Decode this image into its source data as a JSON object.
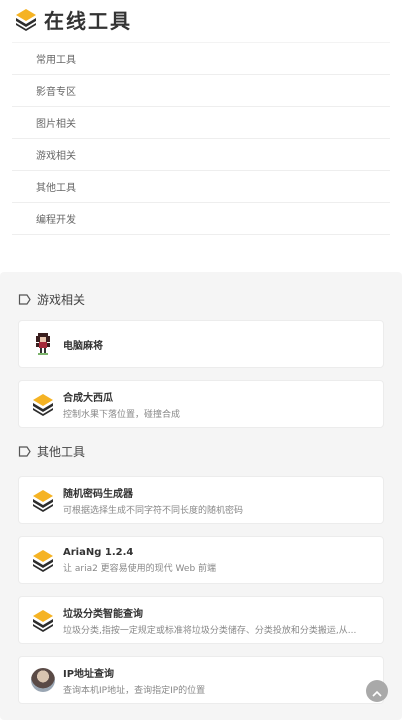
{
  "header": {
    "title": "在线工具",
    "logo_icon": "layers-icon"
  },
  "nav": {
    "items": [
      {
        "label": "常用工具"
      },
      {
        "label": "影音专区"
      },
      {
        "label": "图片相关"
      },
      {
        "label": "游戏相关"
      },
      {
        "label": "其他工具"
      },
      {
        "label": "编程开发"
      }
    ]
  },
  "sections": [
    {
      "title": "游戏相关",
      "icon": "tag-icon",
      "cards": [
        {
          "title": "电脑麻将",
          "desc": "",
          "icon": "pixel-character-icon"
        },
        {
          "title": "合成大西瓜",
          "desc": "控制水果下落位置，碰撞合成",
          "icon": "layers-icon"
        }
      ]
    },
    {
      "title": "其他工具",
      "icon": "tag-icon",
      "cards": [
        {
          "title": "随机密码生成器",
          "desc": "可根据选择生成不同字符不同长度的随机密码",
          "icon": "layers-icon"
        },
        {
          "title": "AriaNg 1.2.4",
          "desc": "让 aria2 更容易使用的现代 Web 前端",
          "icon": "layers-icon"
        },
        {
          "title": "垃圾分类智能查询",
          "desc": "垃圾分类,指按一定规定或标准将垃圾分类储存、分类投放和分类搬运,从...",
          "icon": "layers-icon"
        },
        {
          "title": "IP地址查询",
          "desc": "查询本机IP地址，查询指定IP的位置",
          "icon": "avatar-icon"
        }
      ]
    }
  ],
  "colors": {
    "logo_top": "#f5b324",
    "logo_bottom": "#2d2d2d",
    "background": "#f5f5f5",
    "back_to_top": "#a9a9a9"
  }
}
